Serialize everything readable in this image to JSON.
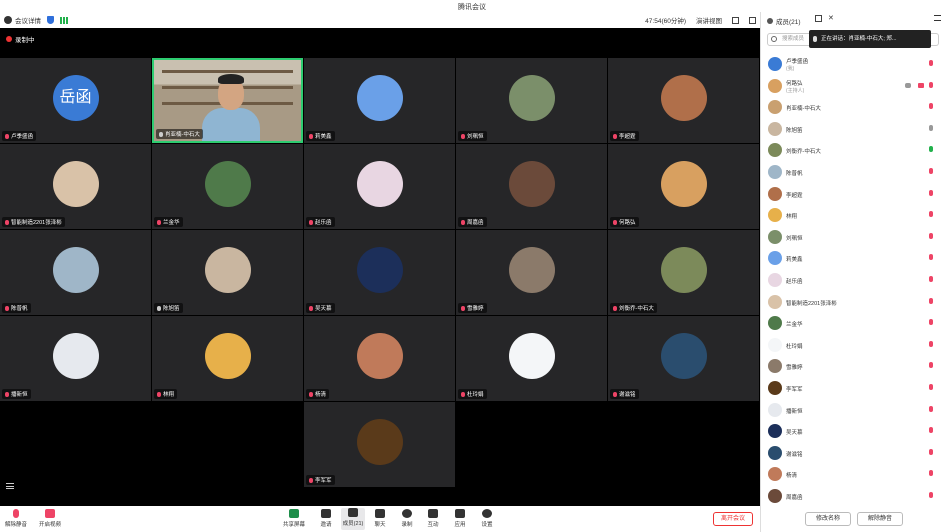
{
  "window": {
    "title": "腾讯会议"
  },
  "toolbar": {
    "meeting_info": "会议详情",
    "timer": "47:54(60分钟)",
    "view": "演讲视图"
  },
  "recording": "录制中",
  "tiles": [
    {
      "name": "卢季盛函",
      "kind": "initials",
      "initials": "岳函",
      "color": "#3a7bd5",
      "mic": "off"
    },
    {
      "name": "肖亚楠-中石大",
      "kind": "camera",
      "mic": "on",
      "active": true
    },
    {
      "name": "莉美鑫",
      "kind": "avatar",
      "color": "#6aa0e8",
      "mic": "off"
    },
    {
      "name": "刘珮恒",
      "kind": "avatar",
      "color": "#7b8f6a",
      "mic": "off"
    },
    {
      "name": "李超霆",
      "kind": "avatar",
      "color": "#b06f4a",
      "mic": "off"
    },
    {
      "name": "智能制造2201张泽彬",
      "kind": "avatar",
      "color": "#d9c2a8",
      "mic": "off"
    },
    {
      "name": "兰金华",
      "kind": "avatar",
      "color": "#4f7a4a",
      "mic": "off"
    },
    {
      "name": "赵乐函",
      "kind": "avatar",
      "color": "#e8d6e2",
      "mic": "off"
    },
    {
      "name": "周嘉函",
      "kind": "avatar",
      "color": "#6b4a3a",
      "mic": "off"
    },
    {
      "name": "何路弘",
      "kind": "avatar",
      "color": "#d8a060",
      "mic": "off"
    },
    {
      "name": "陈普帆",
      "kind": "avatar",
      "color": "#9fb6c8",
      "mic": "off"
    },
    {
      "name": "陈旭笛",
      "kind": "avatar",
      "color": "#c9b6a0",
      "mic": "on"
    },
    {
      "name": "吴天慕",
      "kind": "avatar",
      "color": "#1c2f5a",
      "mic": "off"
    },
    {
      "name": "雪雅婷",
      "kind": "avatar",
      "color": "#8b7a6a",
      "mic": "off"
    },
    {
      "name": "刘衡乔-中石大",
      "kind": "avatar",
      "color": "#7c8a5a",
      "mic": "off"
    },
    {
      "name": "播新恒",
      "kind": "avatar",
      "color": "#e6e9ee",
      "mic": "off"
    },
    {
      "name": "林翔",
      "kind": "avatar",
      "color": "#e7b04a",
      "mic": "off"
    },
    {
      "name": "杨清",
      "kind": "avatar",
      "color": "#c07a5a",
      "mic": "off"
    },
    {
      "name": "杜玲娟",
      "kind": "avatar",
      "color": "#f4f6f8",
      "mic": "off"
    },
    {
      "name": "谢滋铭",
      "kind": "avatar",
      "color": "#2a4d6e",
      "mic": "off"
    },
    {
      "name": "李军军",
      "kind": "avatar",
      "color": "#5a3a1a",
      "mic": "off"
    }
  ],
  "bottombar": {
    "mute": "解除静音",
    "video": "开启视频",
    "share": "共享屏幕",
    "invite": "邀请",
    "members": "成员(21)",
    "chat": "聊天",
    "record": "录制",
    "interact": "互动",
    "apps": "应用",
    "settings": "设置",
    "leave": "离开会议"
  },
  "panel": {
    "title": "成员(21)",
    "search_placeholder": "搜索成员",
    "speaking": "正在讲话：肖亚楠-中石大; 郑...",
    "mute_all": "修改名称",
    "unmute_all": "解除静音"
  },
  "members": [
    {
      "name": "卢季盛函",
      "sub": "(我)",
      "color": "#3a7bd5",
      "mic": "off"
    },
    {
      "name": "何路弘",
      "sub": "(主持人)",
      "color": "#d8a060",
      "mic": "off",
      "host": true
    },
    {
      "name": "肖亚楠-中石大",
      "color": "#c9a070",
      "mic": "off"
    },
    {
      "name": "陈旭笛",
      "color": "#c9b6a0",
      "mic": "grey"
    },
    {
      "name": "刘衡乔-中石大",
      "color": "#7c8a5a",
      "mic": "on"
    },
    {
      "name": "陈普帆",
      "color": "#9fb6c8",
      "mic": "off"
    },
    {
      "name": "李超霆",
      "color": "#b06f4a",
      "mic": "off"
    },
    {
      "name": "林翔",
      "color": "#e7b04a",
      "mic": "off"
    },
    {
      "name": "刘珮恒",
      "color": "#7b8f6a",
      "mic": "off"
    },
    {
      "name": "莉美鑫",
      "color": "#6aa0e8",
      "mic": "off"
    },
    {
      "name": "赵乐函",
      "color": "#e8d6e2",
      "mic": "off"
    },
    {
      "name": "智能制造2201张泽彬",
      "color": "#d9c2a8",
      "mic": "off"
    },
    {
      "name": "兰金华",
      "color": "#4f7a4a",
      "mic": "off"
    },
    {
      "name": "杜玲娟",
      "color": "#f4f6f8",
      "mic": "off"
    },
    {
      "name": "雪雅婷",
      "color": "#8b7a6a",
      "mic": "off"
    },
    {
      "name": "李军军",
      "color": "#5a3a1a",
      "mic": "off"
    },
    {
      "name": "播新恒",
      "color": "#e6e9ee",
      "mic": "off"
    },
    {
      "name": "吴天慕",
      "color": "#1c2f5a",
      "mic": "off"
    },
    {
      "name": "谢滋铭",
      "color": "#2a4d6e",
      "mic": "off"
    },
    {
      "name": "杨清",
      "color": "#c07a5a",
      "mic": "off"
    },
    {
      "name": "周嘉函",
      "color": "#6b4a3a",
      "mic": "off"
    }
  ]
}
